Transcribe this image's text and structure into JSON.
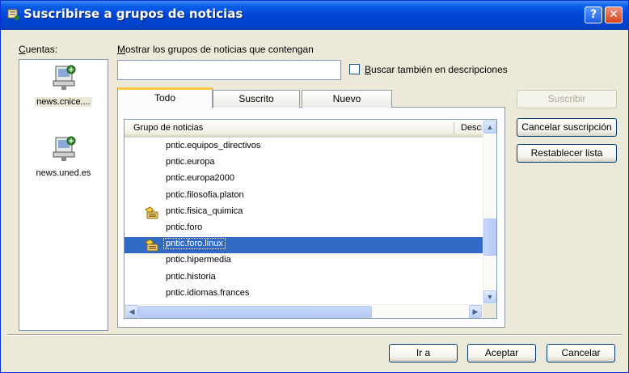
{
  "window": {
    "title": "Suscribirse a grupos de noticias",
    "help_label": "?",
    "close_label": "✕"
  },
  "accounts": {
    "label": "Cuentas:",
    "items": [
      {
        "name": "news.cnice....",
        "icon": "news-server-icon",
        "selected": true
      },
      {
        "name": "news.uned.es",
        "icon": "news-server-icon",
        "selected": false
      }
    ]
  },
  "search": {
    "label": "Mostrar los grupos de noticias que contengan",
    "value": "",
    "also_descriptions_label": "Buscar también en descripciones",
    "also_descriptions_checked": false
  },
  "tabs": [
    {
      "label": "Todo",
      "active": true
    },
    {
      "label": "Suscrito",
      "active": false
    },
    {
      "label": "Nuevo",
      "active": false
    }
  ],
  "list": {
    "columns": [
      "Grupo de noticias",
      "Descripción"
    ],
    "rows": [
      {
        "name": "pntic.equipos_directivos",
        "icon": ""
      },
      {
        "name": "pntic.europa",
        "icon": ""
      },
      {
        "name": "pntic.europa2000",
        "icon": ""
      },
      {
        "name": "pntic.filosofia.platon",
        "icon": ""
      },
      {
        "name": "pntic.fisica_quimica",
        "icon": "subscribed-newsgroup-icon"
      },
      {
        "name": "pntic.foro",
        "icon": ""
      },
      {
        "name": "pntic.foro.linux",
        "icon": "subscribed-newsgroup-icon",
        "selected": true
      },
      {
        "name": "pntic.hipermedia",
        "icon": ""
      },
      {
        "name": "pntic.historia",
        "icon": ""
      },
      {
        "name": "pntic.idiomas.frances",
        "icon": ""
      }
    ]
  },
  "side_buttons": {
    "subscribe": "Suscribir",
    "unsubscribe": "Cancelar suscripción",
    "reset": "Restablecer lista"
  },
  "footer": {
    "goto": "Ir a",
    "ok": "Aceptar",
    "cancel": "Cancelar"
  },
  "colors": {
    "titlebar": "#0046d5",
    "selection": "#316ac5",
    "tab_highlight": "#ffc83c",
    "dialog_bg": "#ece9d8"
  }
}
